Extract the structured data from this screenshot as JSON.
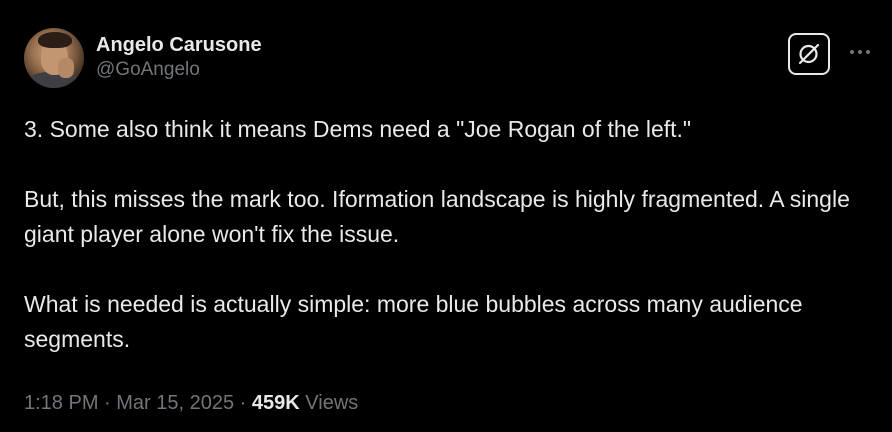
{
  "author": {
    "display_name": "Angelo Carusone",
    "handle": "@GoAngelo"
  },
  "icons": {
    "grok": "grok-icon",
    "more": "more-horizontal-icon"
  },
  "tweet": {
    "paragraphs": [
      "3. Some also think it means Dems need a \"Joe Rogan of the left.\"",
      "But, this misses the mark too. Iformation landscape is highly fragmented. A single giant player alone won't fix the issue.",
      "What is needed is actually simple: more blue bubbles across many audience segments."
    ]
  },
  "meta": {
    "time": "1:18 PM",
    "separator": " · ",
    "date": "Mar 15, 2025",
    "views_count": "459K",
    "views_label": "Views"
  },
  "colors": {
    "background": "#000000",
    "text_primary": "#e7e9ea",
    "text_secondary": "#71767b"
  }
}
